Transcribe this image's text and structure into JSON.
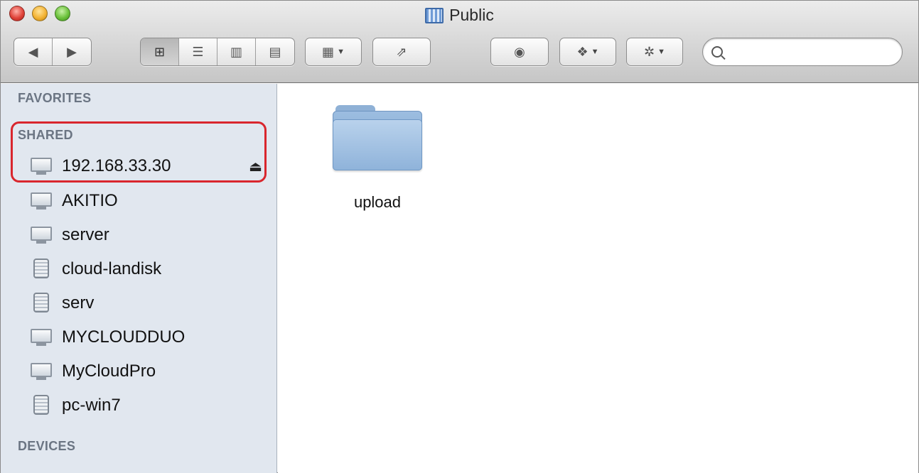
{
  "window": {
    "title": "Public"
  },
  "search": {
    "placeholder": ""
  },
  "toolbar": {
    "back_icon": "back-arrow-icon",
    "forward_icon": "forward-arrow-icon",
    "view_modes": [
      "icon-view",
      "list-view",
      "column-view",
      "cover-flow-view"
    ],
    "arrange_icon": "arrange-grid-icon",
    "share_icon": "share-icon",
    "quicklook_icon": "eye-icon",
    "dropbox_icon": "dropbox-icon",
    "action_icon": "gear-icon"
  },
  "sidebar": {
    "favorites_heading": "FAVORITES",
    "shared_heading": "SHARED",
    "devices_heading": "DEVICES",
    "shared_items": [
      {
        "label": "192.168.33.30",
        "icon": "monitor-icon",
        "ejectable": true
      },
      {
        "label": "AKITIO",
        "icon": "monitor-icon"
      },
      {
        "label": "server",
        "icon": "monitor-icon"
      },
      {
        "label": "cloud-landisk",
        "icon": "pc-tower-icon"
      },
      {
        "label": "serv",
        "icon": "pc-tower-icon"
      },
      {
        "label": "MYCLOUDDUO",
        "icon": "monitor-icon"
      },
      {
        "label": "MyCloudPro",
        "icon": "monitor-icon"
      },
      {
        "label": "pc-win7",
        "icon": "pc-tower-icon"
      }
    ]
  },
  "content": {
    "items": [
      {
        "name": "upload",
        "icon": "folder-icon"
      }
    ]
  },
  "colors": {
    "highlight": "#d9262d",
    "sidebar_bg": "#e1e7ef",
    "folder": "#8fb3da"
  }
}
